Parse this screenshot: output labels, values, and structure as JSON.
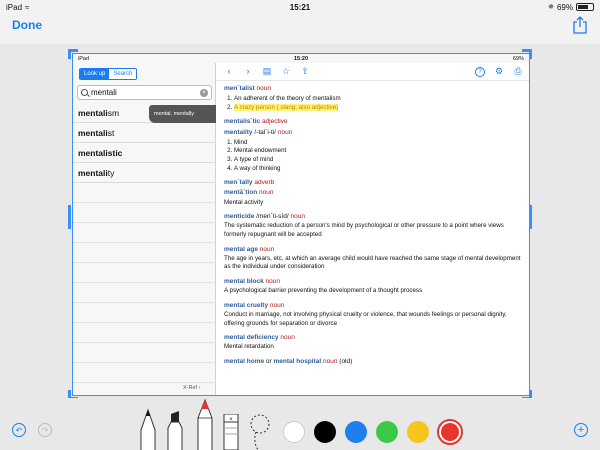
{
  "status_bar": {
    "device": "iPad",
    "time": "15:21",
    "battery": "69%",
    "battery_level": 0.69
  },
  "top_bar": {
    "done_label": "Done",
    "share_icon": "share-icon"
  },
  "inner_status": {
    "device": "iPad",
    "time": "15:20",
    "battery": "69%"
  },
  "segment": {
    "lookup_label": "Look up",
    "search_label": "Search"
  },
  "search": {
    "value": "mentali"
  },
  "suggestion": "mental, mentally",
  "word_list": [
    {
      "prefix": "mentali",
      "suffix": "sm"
    },
    {
      "prefix": "mentali",
      "suffix": "st"
    },
    {
      "prefix": "mentalistic",
      "suffix": ""
    },
    {
      "prefix": "mentali",
      "suffix": "ty"
    }
  ],
  "xref_label": "X-Ref",
  "entries": {
    "e1_hw": "men´talist",
    "e1_pos": "noun",
    "e1_def1": "An adherent of the theory of mentalism",
    "e1_def2": "A crazy person ( slang, also adjective)",
    "e2_hw": "mentalis´tic",
    "e2_pos": "adjective",
    "e3_hw": "mentality",
    "e3_pron": "/-tal´i-ti/",
    "e3_pos": "noun",
    "e3_defs": [
      "Mind",
      "Mental endowment",
      "A type of mind",
      "A way of thinking"
    ],
    "e4_hw": "men´tally",
    "e4_pos": "adverb",
    "e5_hw": "mentā´tion",
    "e5_pos": "noun",
    "e5_def": "Mental activity",
    "e6_hw": "menticide",
    "e6_pron": "/men´ti-sīd/",
    "e6_pos": "noun",
    "e6_def": "The systematic reduction of a person's mind by psychological or other pressure to a point where views formerly repugnant will be accepted",
    "e7_hw": "mental age",
    "e7_pos": "noun",
    "e7_def": "The age in years, etc, at which an average child would have reached the same stage of mental development as the individual under consideration",
    "e8_hw": "mental block",
    "e8_pos": "noun",
    "e8_def": "A psychological barrier preventing the development of a thought process",
    "e9_hw": "mental cruelty",
    "e9_pos": "noun",
    "e9_def": "Conduct in marriage, not involving physical cruelty or violence, that wounds feelings or personal dignity, offering grounds for separation or divorce",
    "e10_hw": "mental deficiency",
    "e10_pos": "noun",
    "e10_def": "Mental retardation",
    "e11_hw1": "mental home",
    "e11_or": "or",
    "e11_hw2": "mental hospital",
    "e11_pos": "noun",
    "e11_note": "(old)"
  },
  "drawing_tools": {
    "undo_icon": "undo-icon",
    "redo_icon": "redo-icon",
    "add_icon": "add-icon",
    "colors": [
      "#ffffff",
      "#000000",
      "#1e7ff0",
      "#3cc94a",
      "#f7c51b",
      "#e8342b"
    ]
  }
}
